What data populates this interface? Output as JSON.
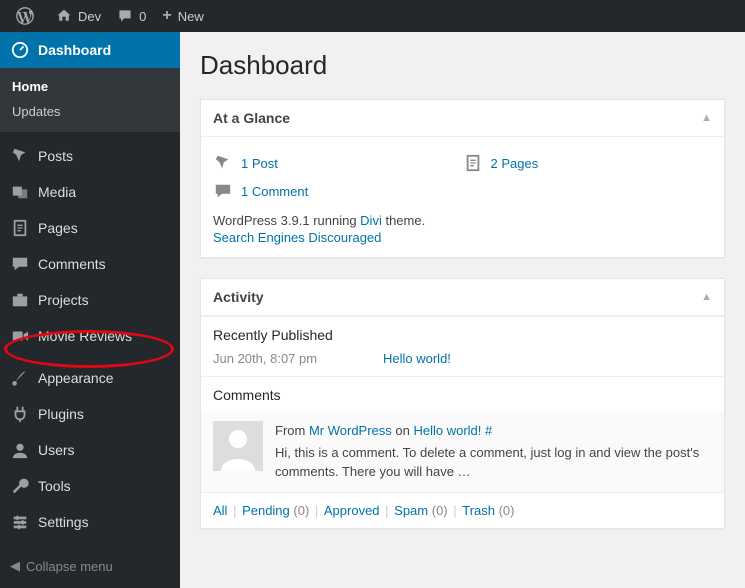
{
  "adminbar": {
    "site_name": "Dev",
    "comments_count": "0",
    "new_label": "New"
  },
  "sidebar": {
    "items": [
      {
        "label": "Dashboard",
        "icon": "dashboard",
        "current": true
      },
      {
        "label": "Posts",
        "icon": "pin"
      },
      {
        "label": "Media",
        "icon": "media"
      },
      {
        "label": "Pages",
        "icon": "page"
      },
      {
        "label": "Comments",
        "icon": "comment"
      },
      {
        "label": "Projects",
        "icon": "portfolio"
      },
      {
        "label": "Movie Reviews",
        "icon": "video"
      },
      {
        "label": "Appearance",
        "icon": "brush"
      },
      {
        "label": "Plugins",
        "icon": "plug"
      },
      {
        "label": "Users",
        "icon": "user"
      },
      {
        "label": "Tools",
        "icon": "wrench"
      },
      {
        "label": "Settings",
        "icon": "settings"
      }
    ],
    "submenu": [
      {
        "label": "Home",
        "current": true
      },
      {
        "label": "Updates"
      }
    ],
    "collapse_label": "Collapse menu"
  },
  "page": {
    "title": "Dashboard"
  },
  "glance": {
    "title": "At a Glance",
    "items": [
      {
        "label": "1 Post",
        "icon": "pin"
      },
      {
        "label": "2 Pages",
        "icon": "page"
      },
      {
        "label": "1 Comment",
        "icon": "comment"
      }
    ],
    "version_prefix": "WordPress 3.9.1 running ",
    "theme_name": "Divi",
    "version_suffix": " theme.",
    "seo_text": "Search Engines Discouraged"
  },
  "activity": {
    "title": "Activity",
    "recent_title": "Recently Published",
    "recent": {
      "time": "Jun 20th, 8:07 pm",
      "post": "Hello world!"
    },
    "comments_title": "Comments",
    "comment": {
      "from_label": "From ",
      "author": "Mr WordPress",
      "on_label": " on ",
      "post": "Hello world!",
      "hash": " #",
      "text": "Hi, this is a comment. To delete a comment, just log in and view the post's comments. There you will have …"
    },
    "filters": [
      {
        "label": "All",
        "count": ""
      },
      {
        "label": "Pending",
        "count": "(0)"
      },
      {
        "label": "Approved",
        "count": ""
      },
      {
        "label": "Spam",
        "count": "(0)"
      },
      {
        "label": "Trash",
        "count": "(0)"
      }
    ]
  }
}
